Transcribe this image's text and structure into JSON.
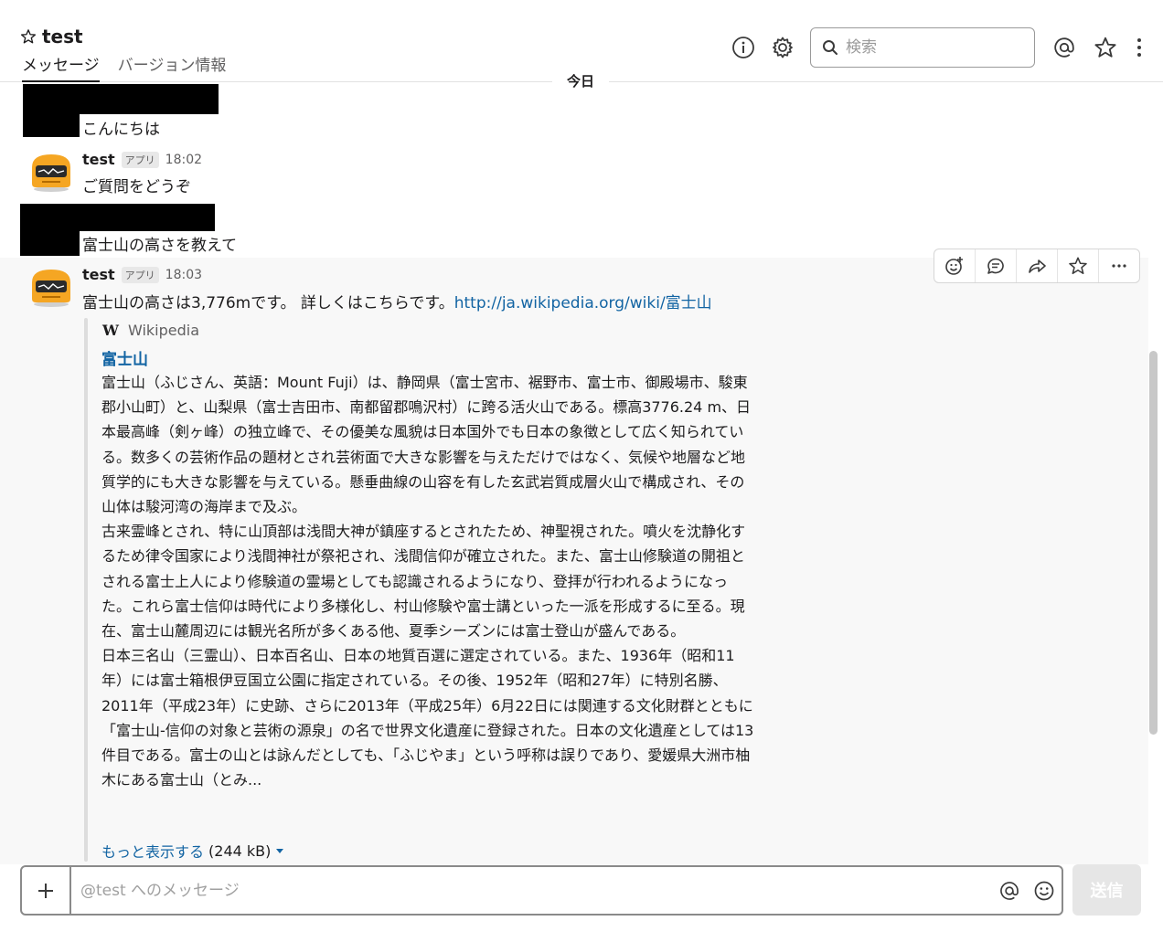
{
  "header": {
    "channel_name": "test",
    "tabs": [
      "メッセージ",
      "バージョン情報"
    ],
    "search_placeholder": "検索"
  },
  "day_divider": "今日",
  "messages": [
    {
      "sender": null,
      "text": "こんにちは",
      "redacted_sender": true
    },
    {
      "sender": "test",
      "badge": "アプリ",
      "time": "18:02",
      "text": "ご質問をどうぞ"
    },
    {
      "sender": null,
      "text": "富士山の高さを教えて",
      "redacted_sender": true
    },
    {
      "sender": "test",
      "badge": "アプリ",
      "time": "18:03",
      "text": "富士山の高さは3,776mです。 詳しくはこちらです。",
      "link": "http://ja.wikipedia.org/wiki/富士山",
      "attachment": {
        "source_icon": "W",
        "source": "Wikipedia",
        "title": "富士山",
        "paragraphs": [
          "富士山（ふじさん、英語：Mount Fuji）は、静岡県（富士宮市、裾野市、富士市、御殿場市、駿東郡小山町）と、山梨県（富士吉田市、南都留郡鳴沢村）に跨る活火山である。標高3776.24 m、日本最高峰（剣ヶ峰）の独立峰で、その優美な風貌は日本国外でも日本の象徴として広く知られている。数多くの芸術作品の題材とされ芸術面で大きな影響を与えただけではなく、気候や地層など地質学的にも大きな影響を与えている。懸垂曲線の山容を有した玄武岩質成層火山で構成され、その山体は駿河湾の海岸まで及ぶ。",
          "古来霊峰とされ、特に山頂部は浅間大神が鎮座するとされたため、神聖視された。噴火を沈静化するため律令国家により浅間神社が祭祀され、浅間信仰が確立された。また、富士山修験道の開祖とされる富士上人により修験道の霊場としても認識されるようになり、登拝が行われるようになった。これら富士信仰は時代により多様化し、村山修験や富士講といった一派を形成するに至る。現在、富士山麓周辺には観光名所が多くある他、夏季シーズンには富士登山が盛んである。",
          "日本三名山（三霊山）、日本百名山、日本の地質百選に選定されている。また、1936年（昭和11年）には富士箱根伊豆国立公園に指定されている。その後、1952年（昭和27年）に特別名勝、2011年（平成23年）に史跡、さらに2013年（平成25年）6月22日には関連する文化財群とともに「富士山-信仰の対象と芸術の源泉」の名で世界文化遺産に登録された。日本の文化遺産としては13件目である。富士の山とは詠んだとしても、「ふじやま」という呼称は誤りであり、愛媛県大洲市柚木にある富士山（とみ..."
        ],
        "show_more": "もっと表示する",
        "size": "(244 kB)"
      }
    }
  ],
  "composer": {
    "placeholder": "@test へのメッセージ",
    "send_label": "送信"
  },
  "colors": {
    "link": "#1264a3",
    "avatar_body": "#f5a623",
    "avatar_screen": "#2b2b2b"
  }
}
